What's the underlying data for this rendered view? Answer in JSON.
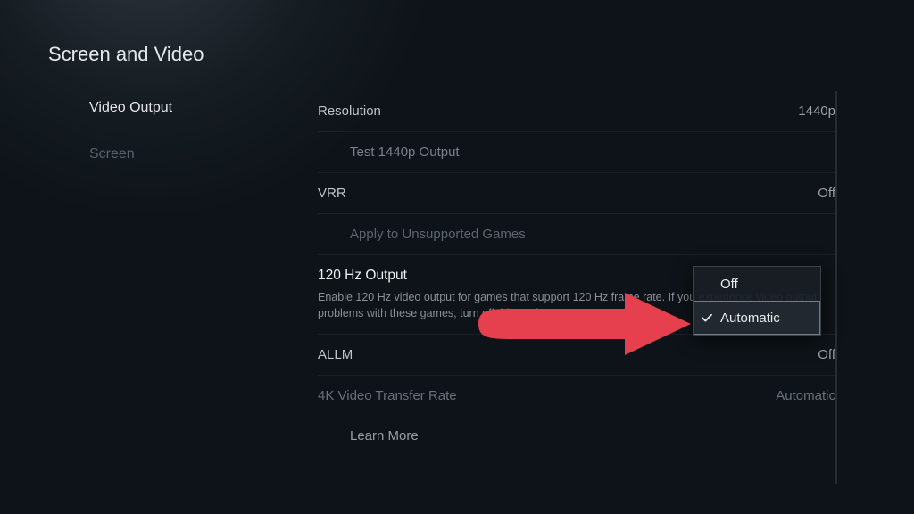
{
  "title": "Screen and Video",
  "sidebar": {
    "items": [
      {
        "label": "Video Output",
        "active": true
      },
      {
        "label": "Screen",
        "active": false
      }
    ]
  },
  "settings": {
    "resolution": {
      "label": "Resolution",
      "value": "1440p"
    },
    "test_1440p": {
      "label": "Test 1440p Output"
    },
    "vrr": {
      "label": "VRR",
      "value": "Off"
    },
    "vrr_unsupported": {
      "label": "Apply to Unsupported Games"
    },
    "output_120hz": {
      "label": "120 Hz Output",
      "description": "Enable 120 Hz video output for games that support 120 Hz frame rate. If you experience video output problems with these games, turn off this setting."
    },
    "allm": {
      "label": "ALLM",
      "value": "Off"
    },
    "transfer_4k": {
      "label": "4K Video Transfer Rate",
      "value": "Automatic"
    },
    "learn_more": {
      "label": "Learn More"
    }
  },
  "dropdown": {
    "options": [
      {
        "label": "Off",
        "selected": false
      },
      {
        "label": "Automatic",
        "selected": true
      }
    ]
  }
}
